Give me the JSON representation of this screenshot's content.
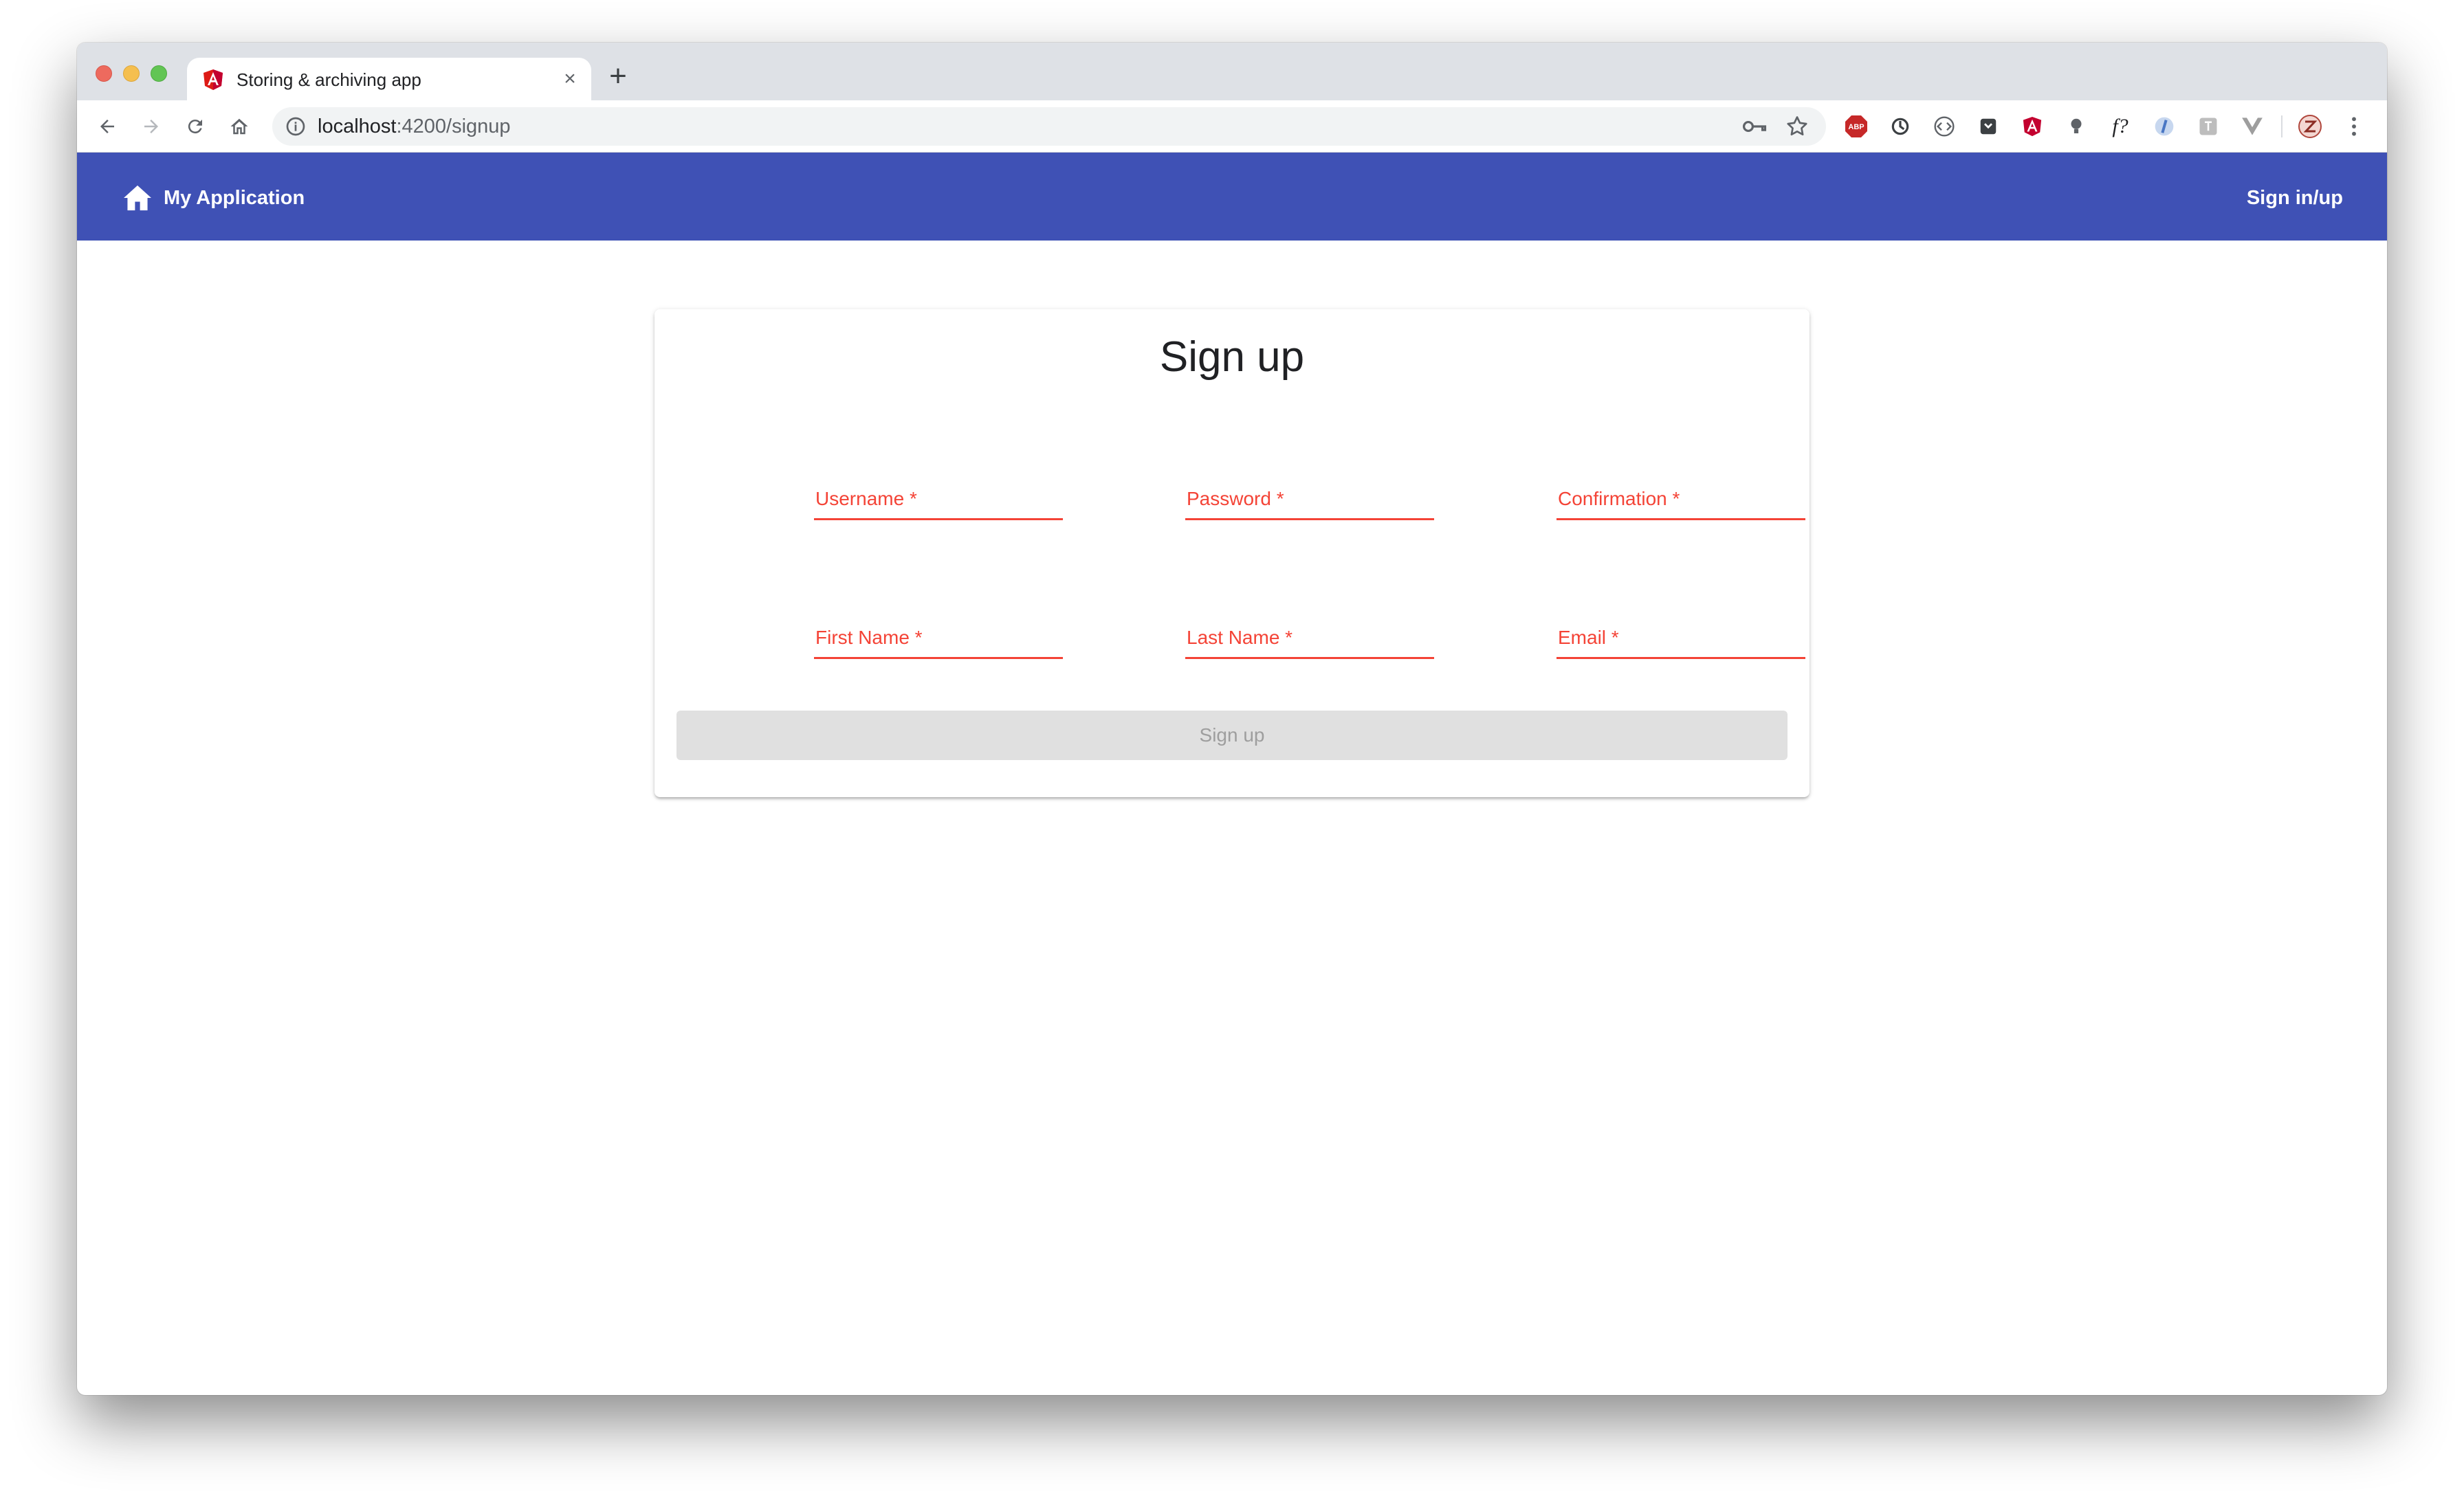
{
  "browser": {
    "tab": {
      "title": "Storing & archiving app",
      "close_glyph": "×",
      "favicon": "angular-icon"
    },
    "new_tab_glyph": "+",
    "url_host": "localhost",
    "url_path": ":4200/signup",
    "extensions": [
      "adblock-icon",
      "sync-icon",
      "code-icon",
      "pocket-icon",
      "angular-devtools-icon",
      "lightbulb-icon",
      "font-inspector-icon",
      "info-icon",
      "translate-icon",
      "vue-icon",
      "profile-avatar-icon",
      "menu-icon"
    ],
    "extension_labels": {
      "font": "f?",
      "abp": "ABP"
    }
  },
  "appbar": {
    "title": "My Application",
    "signin_label": "Sign in/up",
    "bg_color": "#3f51b5"
  },
  "signup": {
    "title": "Sign up",
    "fields": [
      {
        "label": "Username *"
      },
      {
        "label": "Password *"
      },
      {
        "label": "Confirmation *"
      },
      {
        "label": "First Name *"
      },
      {
        "label": "Last Name *"
      },
      {
        "label": "Email *"
      }
    ],
    "submit_label": "Sign up",
    "error_color": "#f44336"
  }
}
